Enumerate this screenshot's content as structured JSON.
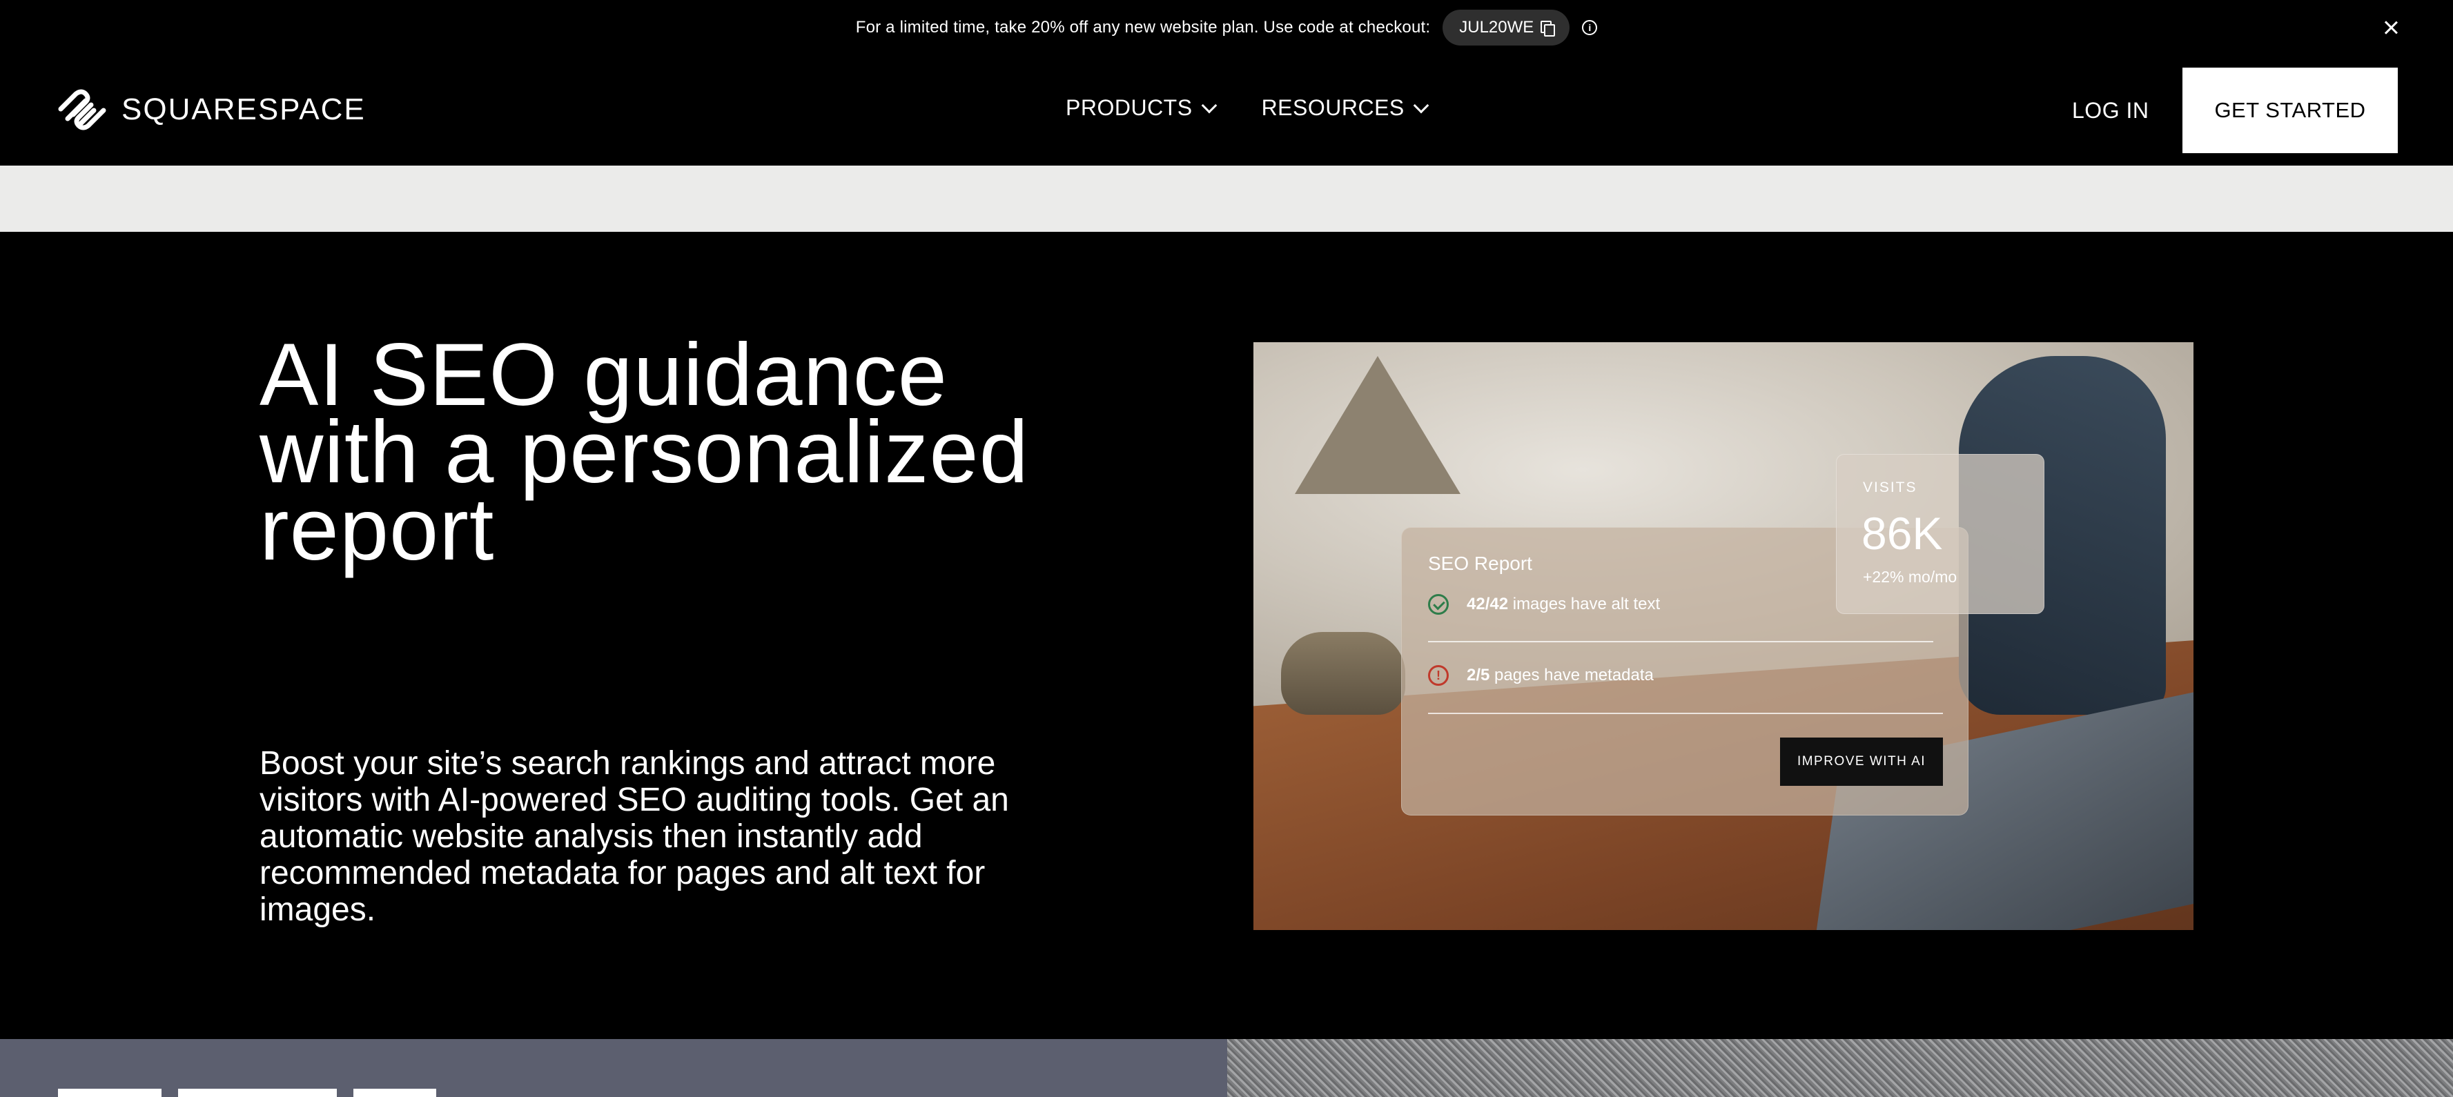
{
  "promo": {
    "text": "For a limited time, take 20% off any new website plan. Use code at checkout:",
    "code": "JUL20WE"
  },
  "nav": {
    "logo_text": "SQUARESPACE",
    "menu": [
      {
        "label": "PRODUCTS"
      },
      {
        "label": "RESOURCES"
      }
    ],
    "login_label": "LOG IN",
    "cta_label": "GET STARTED"
  },
  "hero": {
    "title": "AI SEO guidance with a personalized report",
    "body": "Boost your site’s search rankings and attract more visitors with AI-powered SEO auditing tools. Get an automatic website analysis then instantly add recommended metadata for pages and alt text for images."
  },
  "seo_report": {
    "title": "SEO Report",
    "rows": [
      {
        "count": "42/42",
        "text": "images have alt text",
        "status": "ok"
      },
      {
        "count": "2/5",
        "text": "pages have metadata",
        "status": "warning"
      }
    ],
    "button_label": "IMPROVE WITH AI"
  },
  "visits": {
    "label": "VISITS",
    "value": "86K",
    "delta": "+22% mo/mo"
  },
  "icons": {
    "copy": "copy-icon",
    "info": "info-icon",
    "close": "close-icon",
    "chevron": "chevron-down-icon",
    "logo": "squarespace-logo-icon"
  },
  "colors": {
    "background": "#000000",
    "strip": "#ebebea",
    "cta_bg": "#ffffff",
    "ok": "#2e7d4a",
    "warning": "#c0392b",
    "next_section": "#5c5f6f"
  }
}
